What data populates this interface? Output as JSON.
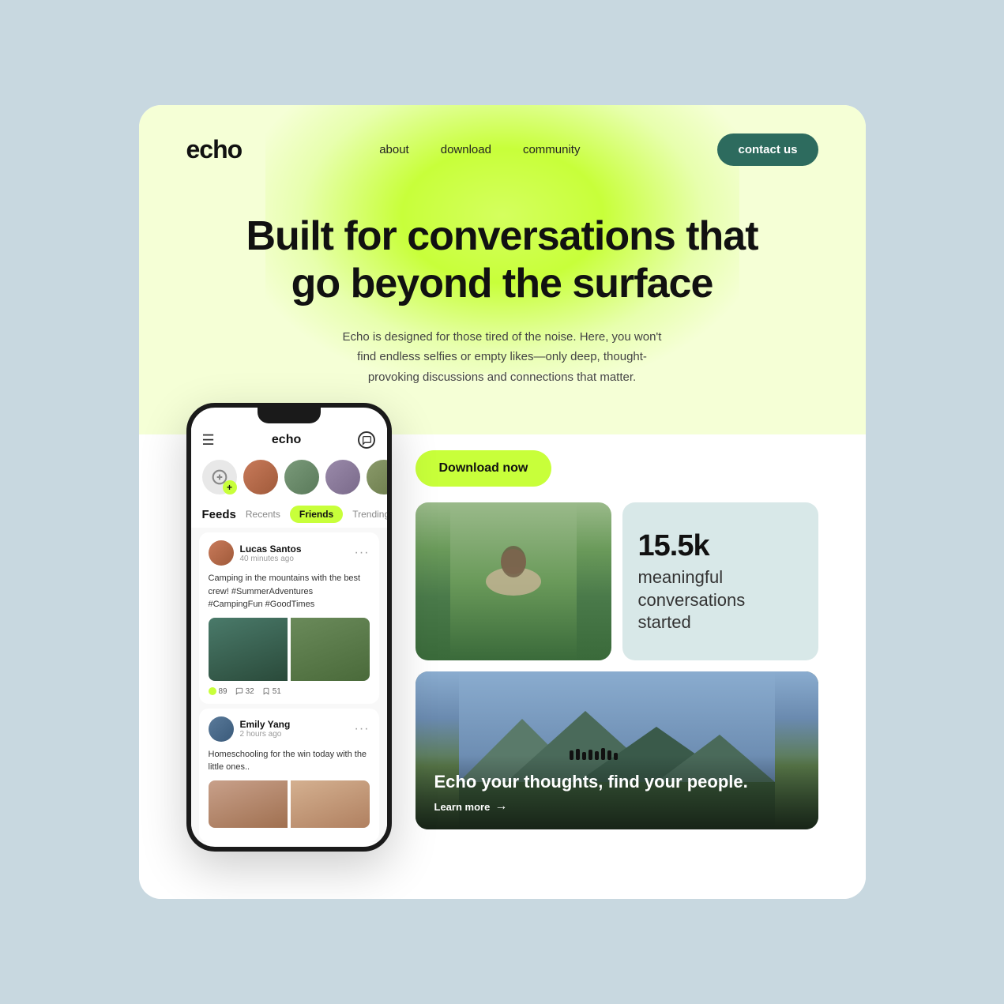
{
  "app": {
    "name": "echo",
    "logo": "echo"
  },
  "nav": {
    "links": [
      {
        "label": "about",
        "href": "#"
      },
      {
        "label": "download",
        "href": "#"
      },
      {
        "label": "community",
        "href": "#"
      }
    ],
    "contact_label": "contact us"
  },
  "hero": {
    "headline": "Built for conversations that go beyond the surface",
    "subtext": "Echo is designed for those tired of the noise. Here, you won't find endless selfies or empty likes—only deep, thought-provoking discussions and connections that matter."
  },
  "phone": {
    "logo": "echo",
    "tabs": {
      "feeds_label": "Feeds",
      "items": [
        "Recents",
        "Friends",
        "Trending"
      ],
      "active": "Friends"
    },
    "stories": [
      {
        "id": "add",
        "type": "add"
      },
      {
        "id": "s1",
        "color": "av1"
      },
      {
        "id": "s2",
        "color": "av2"
      },
      {
        "id": "s3",
        "color": "av3"
      },
      {
        "id": "s4",
        "color": "av4"
      },
      {
        "id": "s5",
        "color": "av5"
      }
    ],
    "posts": [
      {
        "id": "p1",
        "user_name": "Lucas Santos",
        "user_time": "40 minutes ago",
        "text": "Camping in the mountains with the best crew! #SummerAdventures #CampingFun #GoodTimes",
        "has_images": true,
        "reactions": "89",
        "comments": "32",
        "bookmarks": "51"
      },
      {
        "id": "p2",
        "user_name": "Emily Yang",
        "user_time": "2 hours ago",
        "text": "Homeschooling for the win today with the little ones..",
        "has_images": true,
        "reactions": "",
        "comments": "",
        "bookmarks": ""
      }
    ]
  },
  "cta": {
    "download_label": "Download now"
  },
  "stats": {
    "number": "15.5k",
    "label": "meaningful conversations started"
  },
  "wide_card": {
    "title_part1": "Echo your thoughts, find your ",
    "title_bold": "people.",
    "learn_more": "Learn more",
    "arrow": "→"
  }
}
